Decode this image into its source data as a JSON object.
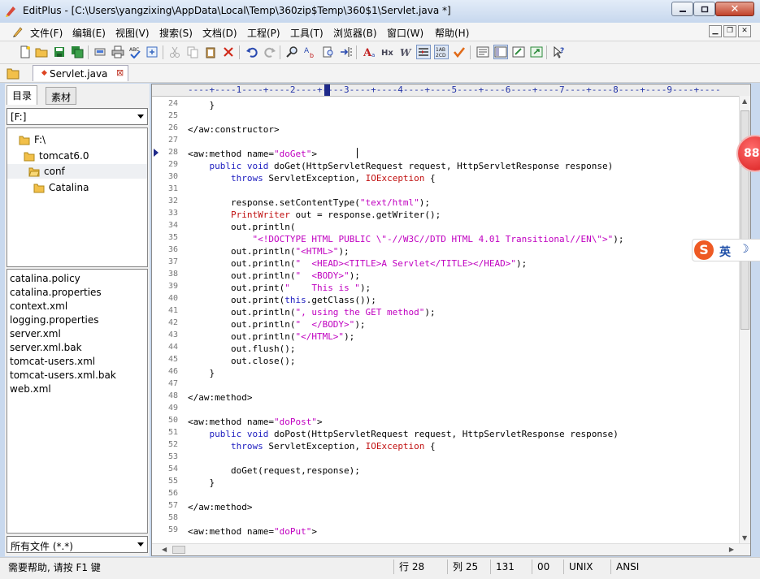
{
  "window": {
    "title": "EditPlus - [C:\\Users\\yangzixing\\AppData\\Local\\Temp\\360zip$Temp\\360$1\\Servlet.java *]",
    "close_glyph": "✕"
  },
  "menu": [
    "文件(F)",
    "编辑(E)",
    "视图(V)",
    "搜索(S)",
    "文档(D)",
    "工程(P)",
    "工具(T)",
    "浏览器(B)",
    "窗口(W)",
    "帮助(H)"
  ],
  "document_tab": {
    "label": "Servlet.java",
    "close_glyph": "⊠"
  },
  "left_panel": {
    "tabs": [
      "目录",
      "素材"
    ],
    "drive": "[F:]",
    "tree": [
      "F:\\",
      "tomcat6.0",
      "conf",
      "Catalina"
    ],
    "files": [
      "catalina.policy",
      "catalina.properties",
      "context.xml",
      "logging.properties",
      "server.xml",
      "server.xml.bak",
      "tomcat-users.xml",
      "tomcat-users.xml.bak",
      "web.xml"
    ],
    "filter": "所有文件 (*.*)"
  },
  "editor": {
    "ruler": "----+----1----+----2----+----3----+----4----+----5----+----6----+----7----+----8----+----9----+----",
    "line_numbers": [
      "24",
      "25",
      "26",
      "27",
      "28",
      "29",
      "30",
      "31",
      "32",
      "33",
      "34",
      "35",
      "36",
      "37",
      "38",
      "39",
      "40",
      "41",
      "42",
      "43",
      "44",
      "45",
      "46",
      "47",
      "48",
      "49",
      "50",
      "51",
      "52",
      "53",
      "54",
      "55",
      "56",
      "57",
      "58",
      "59"
    ],
    "code": {
      "l24": "    }",
      "l26": "</aw:constructor>",
      "l28a": "<aw:method name=",
      "l28b": "\"doGet\"",
      "l28c": ">",
      "l29a": "    ",
      "l29b": "public void",
      "l29c": " doGet(HttpServletRequest request, HttpServletResponse response)",
      "l30a": "        ",
      "l30b": "throws",
      "l30c": " ServletException, ",
      "l30d": "IOException",
      "l30e": " {",
      "l32a": "        response.setContentType(",
      "l32b": "\"text/html\"",
      "l32c": ");",
      "l33a": "        ",
      "l33b": "PrintWriter",
      "l33c": " out = response.getWriter();",
      "l34": "        out.println(",
      "l35a": "            ",
      "l35b": "\"<!DOCTYPE HTML PUBLIC \\\"-//W3C//DTD HTML 4.01 Transitional//EN\\\">\"",
      "l35c": ");",
      "l36a": "        out.println(",
      "l36b": "\"<HTML>\"",
      "l36c": ");",
      "l37a": "        out.println(",
      "l37b": "\"  <HEAD><TITLE>A Servlet</TITLE></HEAD>\"",
      "l37c": ");",
      "l38a": "        out.println(",
      "l38b": "\"  <BODY>\"",
      "l38c": ");",
      "l39a": "        out.print(",
      "l39b": "\"    This is \"",
      "l39c": ");",
      "l40a": "        out.print(",
      "l40b": "this",
      "l40c": ".getClass());",
      "l41a": "        out.println(",
      "l41b": "\", using the GET method\"",
      "l41c": ");",
      "l42a": "        out.println(",
      "l42b": "\"  </BODY>\"",
      "l42c": ");",
      "l43a": "        out.println(",
      "l43b": "\"</HTML>\"",
      "l43c": ");",
      "l44": "        out.flush();",
      "l45": "        out.close();",
      "l46": "    }",
      "l48": "</aw:method>",
      "l50a": "<aw:method name=",
      "l50b": "\"doPost\"",
      "l50c": ">",
      "l51a": "    ",
      "l51b": "public void",
      "l51c": " doPost(HttpServletRequest request, HttpServletResponse response)",
      "l52a": "        ",
      "l52b": "throws",
      "l52c": " ServletException, ",
      "l52d": "IOException",
      "l52e": " {",
      "l54": "        doGet(request,response);",
      "l55": "    }",
      "l57": "</aw:method>",
      "l59a": "<aw:method name=",
      "l59b": "\"doPut\"",
      "l59c": ">"
    }
  },
  "badge": {
    "percent": "88%"
  },
  "ime": {
    "logo": "S",
    "lang": "英",
    "moon": "☽"
  },
  "status": {
    "help": "需要帮助, 请按 F1 键",
    "row": "行 28",
    "col": "列 25",
    "pos": "131",
    "code": "00",
    "eol": "UNIX",
    "encoding": "ANSI"
  },
  "colors": {
    "keyword": "#2020c0",
    "string": "#c000c0",
    "type": "#c01010"
  }
}
